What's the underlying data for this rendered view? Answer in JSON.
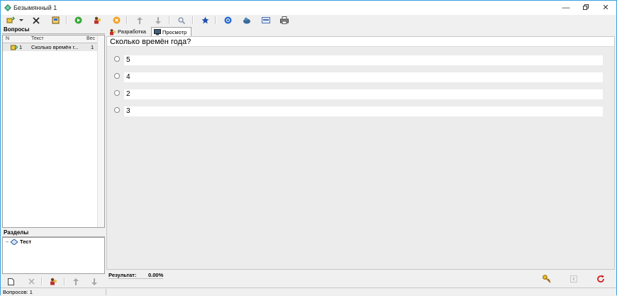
{
  "window": {
    "title": "Безымянный 1"
  },
  "toolbar": {
    "icons": [
      "new-question-icon",
      "dropdown-icon",
      "delete-icon",
      "edit-icon",
      "run-icon",
      "user-icon",
      "stop-icon",
      "move-up-icon",
      "move-down-icon",
      "search-icon",
      "star-icon",
      "help-icon",
      "web-icon",
      "card-icon",
      "print-icon"
    ]
  },
  "questions_panel": {
    "title": "Вопросы",
    "columns": [
      "N",
      "Текст",
      "Вес"
    ],
    "rows": [
      {
        "n": "1",
        "text": "Сколько времён г...",
        "weight": "1"
      }
    ]
  },
  "sections_panel": {
    "title": "Разделы",
    "items": [
      {
        "label": "Тест"
      }
    ]
  },
  "tabs": [
    {
      "label": "Разработка",
      "active": false
    },
    {
      "label": "Просмотр",
      "active": true
    }
  ],
  "preview": {
    "question": "Сколько времён года?",
    "answers": [
      "5",
      "4",
      "2",
      "3"
    ]
  },
  "result": {
    "label": "Результат:",
    "value": "0.00%"
  },
  "statusbar": {
    "text": "Вопросов: 1"
  },
  "colors": {
    "accent_border": "#3aa0e0",
    "selected_row": "#e8e8e8",
    "panel_bg": "#ececec"
  }
}
